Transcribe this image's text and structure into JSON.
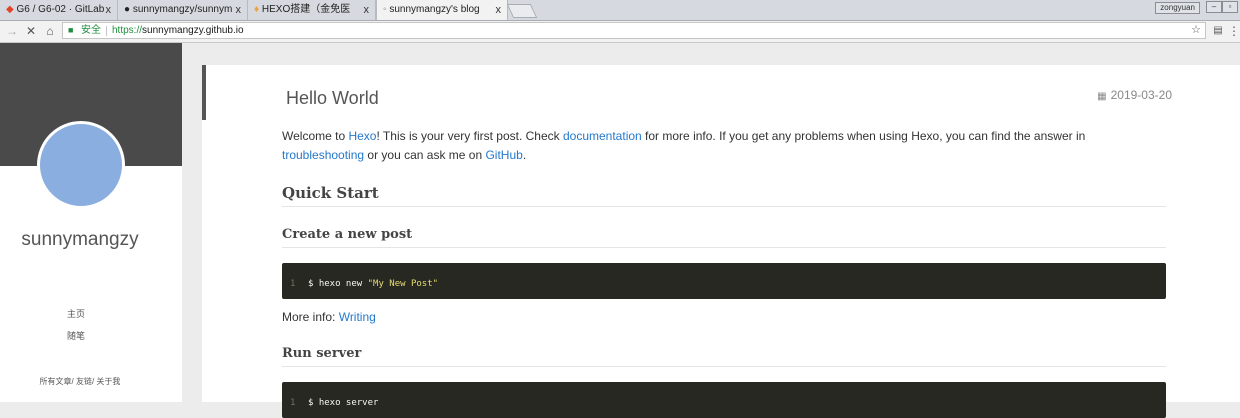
{
  "browser": {
    "tabs": [
      {
        "title": "G6 / G6-02 · GitLab"
      },
      {
        "title": "sunnymangzy/sunnym"
      },
      {
        "title": "HEXO搭建（金免医"
      },
      {
        "title": "sunnymangzy's blog"
      }
    ],
    "close_glyph": "x",
    "user_badge": "zongyuan",
    "address": {
      "secure_label": "安全",
      "scheme": "https://",
      "host": "sunnymangzy.github.io"
    }
  },
  "sidebar": {
    "blog_name": "sunnymangzy",
    "nav": [
      {
        "label": "主页"
      },
      {
        "label": "随笔"
      }
    ],
    "footer_links": "所有文章/ 友链/ 关于我"
  },
  "post": {
    "title": "Hello World",
    "date": "2019-03-20",
    "intro": {
      "p1": "Welcome to ",
      "hexo_link": "Hexo",
      "p2": "! This is your very first post. Check ",
      "doc_link": "documentation",
      "p3": " for more info. If you get any problems when using Hexo, you can find the answer in ",
      "troubleshooting_link": "troubleshooting",
      "p4": " or you can ask me on ",
      "github_link": "GitHub",
      "p5": "."
    },
    "quick_start": "Quick Start",
    "create_post": "Create a new post",
    "code1": {
      "line": "1",
      "cmd": "$ hexo new ",
      "arg": "\"My New Post\""
    },
    "more_info_label": "More info: ",
    "more_info_link": "Writing",
    "run_server": "Run server",
    "code2": {
      "line": "1",
      "cmd": "$ hexo server"
    }
  },
  "colors": {
    "link": "#2479cc",
    "code_bg": "#272822",
    "avatar": "#8aaedf",
    "banner": "#4a4a4a"
  }
}
